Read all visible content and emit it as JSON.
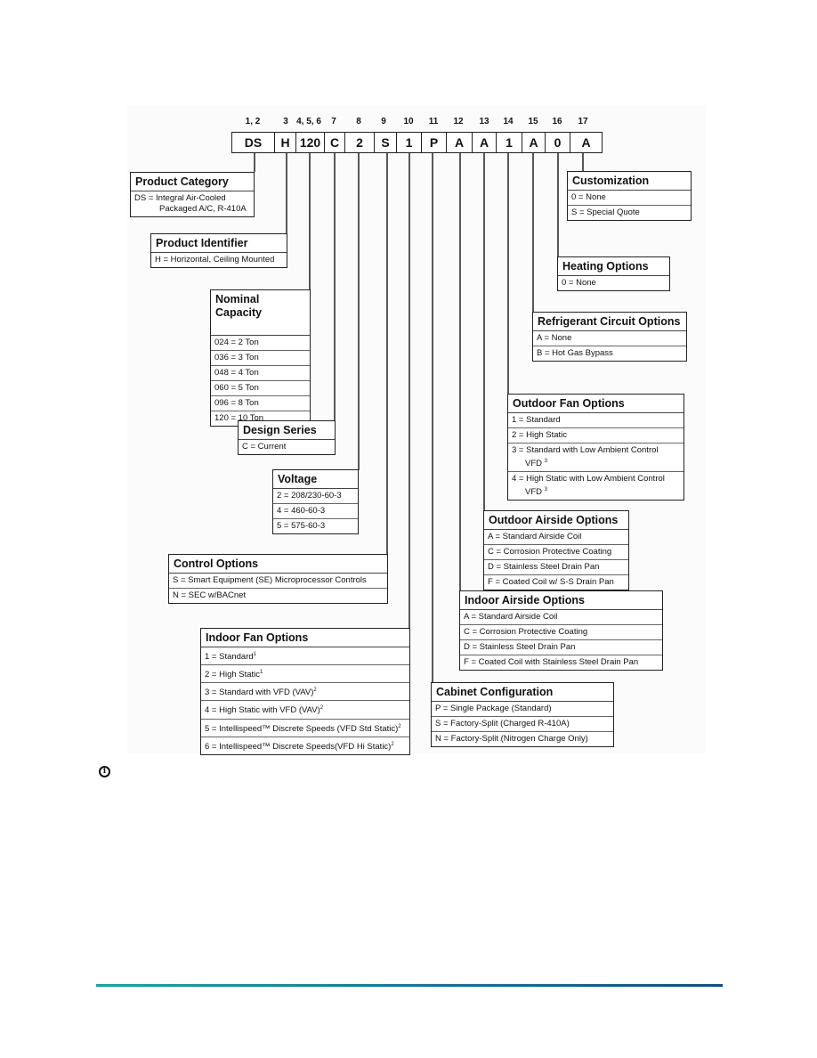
{
  "model_code": {
    "positions": [
      "1, 2",
      "3",
      "4, 5, 6",
      "7",
      "8",
      "9",
      "10",
      "11",
      "12",
      "13",
      "14",
      "15",
      "16",
      "17"
    ],
    "values": [
      "DS",
      "H",
      "120",
      "C",
      "2",
      "S",
      "1",
      "P",
      "A",
      "A",
      "1",
      "A",
      "0",
      "A"
    ]
  },
  "sections": {
    "product_category": {
      "title": "Product Category",
      "rows": [
        {
          "code": "DS = Integral Air-Cooled",
          "cont": "Packaged A/C, R-410A"
        }
      ]
    },
    "product_identifier": {
      "title": "Product Identifier",
      "rows": [
        "H = Horizontal, Ceiling Mounted"
      ]
    },
    "nominal_capacity": {
      "title": "Nominal Capacity",
      "rows": [
        "024 = 2 Ton",
        "036 = 3 Ton",
        "048 = 4 Ton",
        "060 = 5 Ton",
        "096 = 8 Ton",
        "120 = 10 Ton"
      ]
    },
    "design_series": {
      "title": "Design Series",
      "rows": [
        "C = Current"
      ]
    },
    "voltage": {
      "title": "Voltage",
      "rows": [
        "2 = 208/230-60-3",
        "4 = 460-60-3",
        "5 = 575-60-3"
      ]
    },
    "control_options": {
      "title": "Control Options",
      "rows": [
        "S = Smart Equipment (SE) Microprocessor Controls",
        "N = SEC w/BACnet"
      ]
    },
    "indoor_fan_options": {
      "title": "Indoor Fan Options",
      "rows": [
        {
          "text": "1 = Standard",
          "sup": "1"
        },
        {
          "text": "2 = High Static",
          "sup": "1"
        },
        {
          "text": "3 = Standard with VFD (VAV)",
          "sup": "2"
        },
        {
          "text": "4 = High Static with VFD (VAV)",
          "sup": "2"
        },
        {
          "text": "5 = Intellispeed™ Discrete Speeds (VFD Std Static)",
          "sup": "2"
        },
        {
          "text": "6 = Intellispeed™ Discrete Speeds(VFD Hi Static)",
          "sup": "2"
        }
      ]
    },
    "cabinet_configuration": {
      "title": "Cabinet Configuration",
      "rows": [
        "P = Single Package (Standard)",
        "S = Factory-Split (Charged R-410A)",
        "N = Factory-Split (Nitrogen Charge Only)"
      ]
    },
    "indoor_airside_options": {
      "title": "Indoor Airside Options",
      "rows": [
        "A = Standard Airside Coil",
        "C = Corrosion Protective Coating",
        "D = Stainless Steel Drain Pan",
        "F = Coated Coil with Stainless Steel Drain Pan"
      ]
    },
    "outdoor_airside_options": {
      "title": "Outdoor Airside Options",
      "rows": [
        "A = Standard Airside Coil",
        "C = Corrosion Protective Coating",
        "D = Stainless Steel Drain Pan",
        "F = Coated Coil w/ S-S Drain Pan"
      ]
    },
    "outdoor_fan_options": {
      "title": "Outdoor Fan Options",
      "rows": [
        {
          "text": "1 = Standard"
        },
        {
          "text": "2 = High Static"
        },
        {
          "text": "3 = Standard with Low Ambient Control",
          "cont": "VFD",
          "sup": "3"
        },
        {
          "text": "4 = High Static with Low Ambient Control",
          "cont": "VFD",
          "sup": "3"
        }
      ]
    },
    "refrigerant_circuit_options": {
      "title": "Refrigerant Circuit Options",
      "rows": [
        "A = None",
        "B = Hot Gas Bypass"
      ]
    },
    "heating_options": {
      "title": "Heating Options",
      "rows": [
        "0 = None"
      ]
    },
    "customization": {
      "title": "Customization",
      "rows": [
        "0 = None",
        "S = Special Quote"
      ]
    }
  },
  "note_icon": "info-circle-icon",
  "footer_rule_colors": [
    "#1aa39d",
    "#137795",
    "#0f4e85"
  ]
}
